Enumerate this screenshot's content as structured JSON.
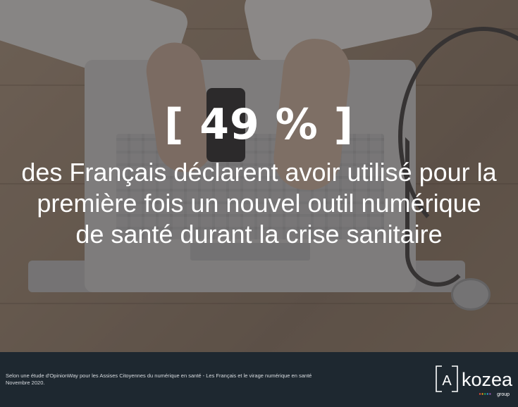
{
  "headline": {
    "stat": "[ 49 % ]",
    "lines": [
      "des Français déclarent avoir utilisé pour la",
      "première fois un nouvel outil numérique",
      "de santé durant la crise sanitaire"
    ]
  },
  "footer": {
    "source_lines": [
      "Selon une étude d'OpinionWay pour les Assises Citoyennes du numérique en santé - Les Français et le virage numérique en santé",
      "Novembre 2020."
    ]
  },
  "logo": {
    "mark_letter": "A",
    "name": "kozea",
    "tagline": "group",
    "dot_colors": [
      "#e74c3c",
      "#f39c12",
      "#27ae60",
      "#3498db",
      "#9b59b6"
    ]
  },
  "colors": {
    "footer_bg": "#1e2830",
    "text": "#ffffff"
  }
}
